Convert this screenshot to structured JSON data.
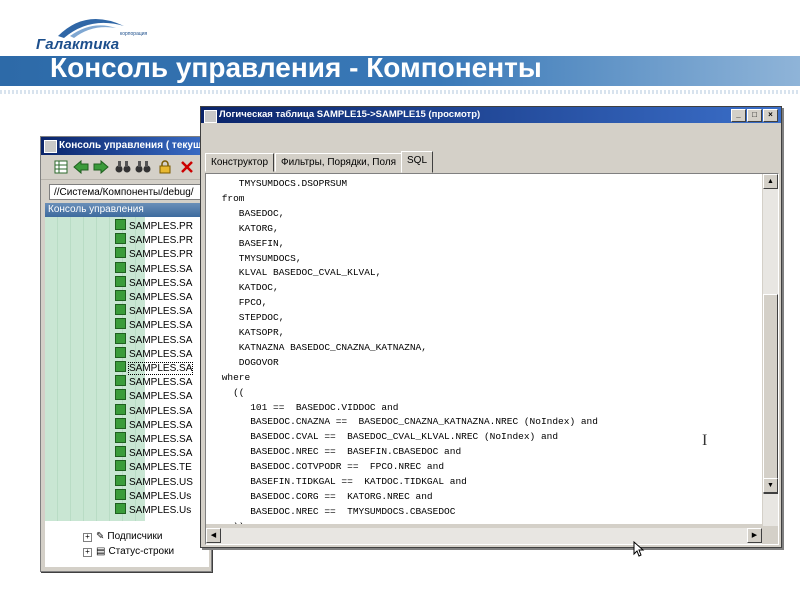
{
  "slide": {
    "logo_text": "Галактика",
    "logo_small": "корпорация",
    "title": "Консоль управления - Компоненты",
    "colors": {
      "title_bar": "#2d6aa8",
      "title_text": "#ffffff",
      "logo": "#1d4f8c"
    }
  },
  "console_window": {
    "title": "Консоль управления ( текущ",
    "toolbar_icons": [
      "grid-icon",
      "back-arrow-icon",
      "forward-arrow-icon",
      "binoculars-icon",
      "binoculars-next-icon",
      "lock-icon",
      "close-icon"
    ],
    "address": "//Система/Компоненты/debug/",
    "tree_header": "Консоль управления",
    "tree_items": [
      "SAMPLES.PR",
      "SAMPLES.PR",
      "SAMPLES.PR",
      "SAMPLES.SA",
      "SAMPLES.SA",
      "SAMPLES.SA",
      "SAMPLES.SA",
      "SAMPLES.SA",
      "SAMPLES.SA",
      "SAMPLES.SA",
      "SAMPLES.SA",
      "SAMPLES.SA",
      "SAMPLES.SA",
      "SAMPLES.SA",
      "SAMPLES.SA",
      "SAMPLES.SA",
      "SAMPLES.SA",
      "SAMPLES.TE",
      "SAMPLES.US",
      "SAMPLES.Us",
      "SAMPLES.Us"
    ],
    "selected_index": 10,
    "tree_nodes": [
      {
        "label": "Подписчики",
        "icon": "signature-icon"
      },
      {
        "label": "Статус-строки",
        "icon": "status-icon"
      }
    ]
  },
  "table_window": {
    "title": "Логическая таблица SAMPLE15->SAMPLE15 (просмотр)",
    "controls": [
      "_",
      "□",
      "×"
    ],
    "tabs": [
      "Конструктор",
      "Фильтры, Порядки, Поля",
      "SQL"
    ],
    "active_tab": 2,
    "sql_lines": [
      "    TMYSUMDOCS.DSOPRSUM",
      " from",
      "    BASEDOC,",
      "    KATORG,",
      "    BASEFIN,",
      "    TMYSUMDOCS,",
      "    KLVAL BASEDOC_CVAL_KLVAL,",
      "    KATDOC,",
      "    FPCO,",
      "    STEPDOC,",
      "    KATSOPR,",
      "    KATNAZNA BASEDOC_CNAZNA_KATNAZNA,",
      "    DOGOVOR",
      " where",
      "   ((",
      "      101 ==  BASEDOC.VIDDOC and",
      "      BASEDOC.CNAZNA ==  BASEDOC_CNAZNA_KATNAZNA.NREC (NoIndex) and",
      "      BASEDOC.CVAL ==  BASEDOC_CVAL_KLVAL.NREC (NoIndex) and",
      "      BASEDOC.NREC ==  BASEFIN.CBASEDOC and",
      "      BASEDOC.COTVPODR ==  FPCO.NREC and",
      "      BASEFIN.TIDKGAL ==  KATDOC.TIDKGAL and",
      "      BASEDOC.CORG ==  KATORG.NREC and",
      "      BASEDOC.NREC ==  TMYSUMDOCS.CBASEDOC",
      "   ))"
    ]
  }
}
